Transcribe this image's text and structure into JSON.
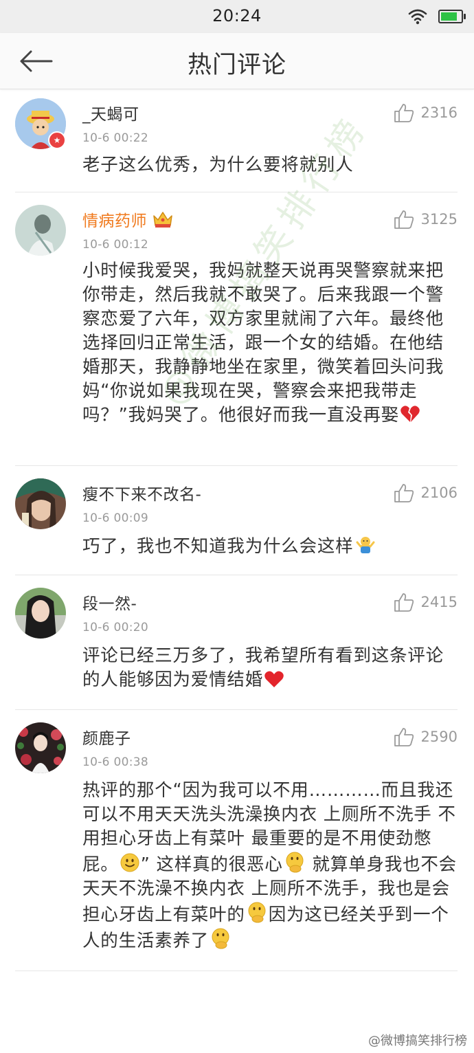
{
  "status_bar": {
    "time": "20:24",
    "battery_level": 0.82,
    "battery_color": "#2ec246"
  },
  "nav": {
    "title": "热门评论",
    "back_icon": "arrow-left-icon"
  },
  "comments": [
    {
      "name": "_天蝎可",
      "time": "10-6 00:22",
      "likes": "2316",
      "text": "老子这么优秀，为什么要将就别人",
      "badge": "★"
    },
    {
      "name": "情病药师",
      "time": "10-6 00:12",
      "likes": "3125",
      "text": "小时候我爱哭，我妈就整天说再哭警察就来把你带走，然后我就不敢哭了。后来我跟一个警察恋爱了六年，双方家里就闹了六年。最终他选择回归正常生活，跟一个女的结婚。在他结婚那天，我静静地坐在家里，微笑着回头问我妈“你说如果我现在哭，警察会来把我带走吗？”我妈哭了。他很好而我一直没再娶",
      "name_color": "#f07a1e"
    },
    {
      "name": "瘦不下来不改名-",
      "time": "10-6 00:09",
      "likes": "2106",
      "text": "巧了，我也不知道我为什么会这样"
    },
    {
      "name": "段一然-",
      "time": "10-6 00:20",
      "likes": "2415",
      "text": "评论已经三万多了，我希望所有看到这条评论的人能够因为爱情结婚"
    },
    {
      "name": "颜鹿子",
      "time": "10-6 00:38",
      "likes": "2590",
      "text_parts": [
        "热评的那个“因为我可以不用…………而且我还可以不用天天洗头洗澡换内衣 上厕所不洗手 不用担心牙齿上有菜叶 最重要的是不用使劲憋屁。",
        "” 这样真的很恶心",
        " 就算单身我也不会天天不洗澡不换内衣 上厕所不洗手，我也是会担心牙齿上有菜叶的",
        "因为这已经关乎到一个人的生活素养了"
      ]
    }
  ],
  "watermark": "@微博搞笑排行榜",
  "footer": "@微博搞笑排行榜"
}
